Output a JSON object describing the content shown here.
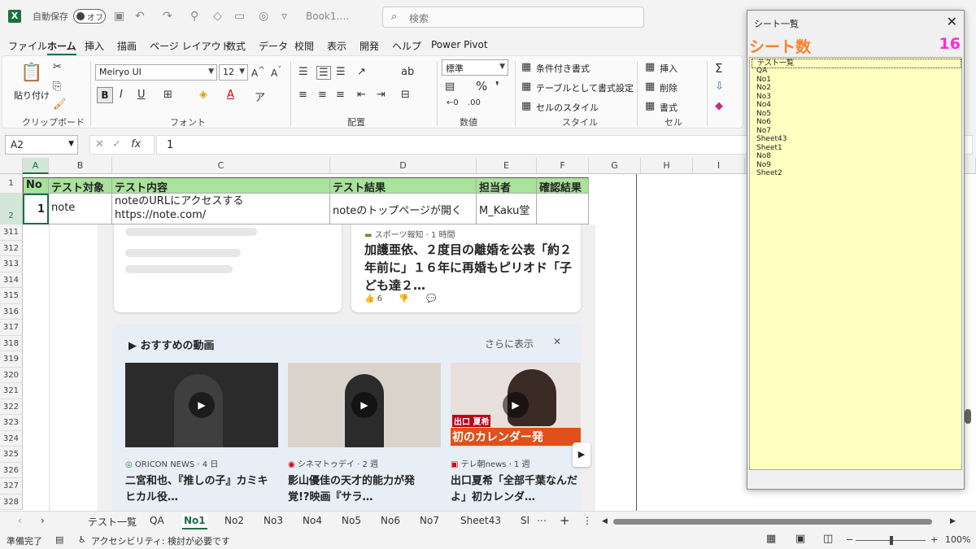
{
  "title_bar": {
    "autosave_label": "自動保存",
    "autosave_state": "オフ",
    "book_name": "Book1.…",
    "search_placeholder": "検索"
  },
  "menu": [
    "ファイル",
    "ホーム",
    "挿入",
    "描画",
    "ページ レイアウト",
    "数式",
    "データ",
    "校閲",
    "表示",
    "開発",
    "ヘルプ",
    "Power Pivot"
  ],
  "ribbon": {
    "paste_label": "貼り付け",
    "clipboard_label": "クリップボード",
    "font_name": "Meiryo UI",
    "font_size": "12",
    "font_group_label": "フォント",
    "bold": "B",
    "italic": "I",
    "underline": "U",
    "alignment_label": "配置",
    "number_format": "標準",
    "number_label": "数値",
    "percent": "%",
    "cond_format": "条件付き書式",
    "table_format": "テーブルとして書式設定",
    "cell_style": "セルのスタイル",
    "style_label": "スタイル",
    "insert": "挿入",
    "delete": "削除",
    "format": "書式",
    "cells_label": "セル"
  },
  "formula_bar": {
    "name_box": "A2",
    "fx": "fx",
    "value": "1"
  },
  "columns": [
    "A",
    "B",
    "C",
    "D",
    "E",
    "F",
    "G",
    "H",
    "I"
  ],
  "header_row": [
    "No",
    "テスト対象",
    "テスト内容",
    "テスト結果",
    "担当者",
    "確認結果"
  ],
  "data_row": {
    "no": "1",
    "target": "note",
    "content_line1": "noteのURLにアクセスする",
    "content_line2": "https://note.com/",
    "result": "noteのトップページが開く",
    "owner": "M_Kaku堂",
    "check": ""
  },
  "row_numbers": [
    "1",
    "2",
    "311",
    "312",
    "313",
    "314",
    "315",
    "316",
    "317",
    "318",
    "319",
    "320",
    "321",
    "322",
    "323",
    "324",
    "325",
    "326",
    "327",
    "328"
  ],
  "news_card": {
    "source": "スポーツ報知 · 1 時間",
    "title": "加護亜依、２度目の離婚を公表「約２年前に」１６年に再婚もピリオド「子ども達２…",
    "likes": "6"
  },
  "videos": {
    "heading": "おすすめの動画",
    "more": "さらに表示",
    "items": [
      {
        "source": "ORICON NEWS · 4 日",
        "title": "二宮和也、『推しの子』カミキヒカル役…"
      },
      {
        "source": "シネマトゥデイ · 2 週",
        "title": "影山優佳の天才的能力が発覚!?映画『サラ…"
      },
      {
        "source": "テレ朝news · 1 週",
        "title": "出口夏希「全部千葉なんだよ」初カレンダ…"
      }
    ],
    "thumb3_caption_top": "出口 夏希",
    "thumb3_caption_bottom": "初のカレンダー発"
  },
  "sheet_tabs": [
    "テスト一覧",
    "QA",
    "No1",
    "No2",
    "No3",
    "No4",
    "No5",
    "No6",
    "No7",
    "Sheet43",
    "Sl"
  ],
  "active_tab": "No1",
  "status": {
    "ready": "準備完了",
    "accessibility": "アクセシビリティ: 検討が必要です",
    "zoom": "100%"
  },
  "dialog": {
    "title": "シート一覧",
    "label": "シート数",
    "count": "16",
    "items": [
      "テスト一覧",
      "QA",
      "No1",
      "No2",
      "No3",
      "No4",
      "No5",
      "No6",
      "No7",
      "Sheet43",
      "Sheet1",
      "No8",
      "No9",
      "Sheet2"
    ]
  },
  "colors": {
    "excel_green": "#1d6f42",
    "header_fill": "#a9e29b",
    "dialog_list_bg": "#ffffc0",
    "dialog_label": "#ff7f27",
    "dialog_count": "#ff2bd6"
  }
}
